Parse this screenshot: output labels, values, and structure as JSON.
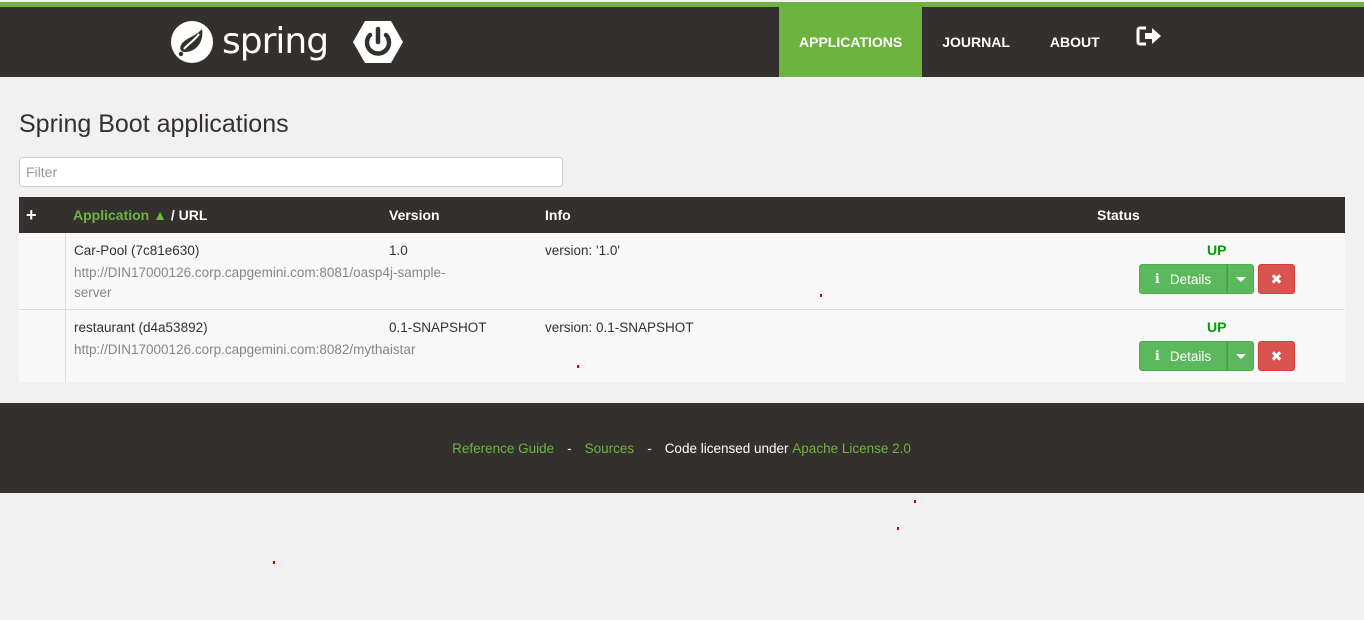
{
  "brand": {
    "name": "spring"
  },
  "nav": {
    "items": [
      {
        "label": "APPLICATIONS",
        "active": true
      },
      {
        "label": "JOURNAL",
        "active": false
      },
      {
        "label": "ABOUT",
        "active": false
      }
    ],
    "logout_icon": "sign-out-icon"
  },
  "page": {
    "title": "Spring Boot applications",
    "filter_placeholder": "Filter"
  },
  "table": {
    "headers": {
      "expand": "+",
      "application": "Application",
      "sort_indicator": "▲",
      "url": "/ URL",
      "version": "Version",
      "info": "Info",
      "status": "Status"
    },
    "rows": [
      {
        "name": "Car-Pool (7c81e630)",
        "url": "http://DIN17000126.corp.capgemini.com:8081/oasp4j-sample-server",
        "version": "1.0",
        "info": "version: '1.0'",
        "status": "UP",
        "details_label": "Details",
        "remove_label": "✖"
      },
      {
        "name": "restaurant (d4a53892)",
        "url": "http://DIN17000126.corp.capgemini.com:8082/mythaistar",
        "version": "0.1-SNAPSHOT",
        "info": "version: 0.1-SNAPSHOT",
        "status": "UP",
        "details_label": "Details",
        "remove_label": "✖"
      }
    ]
  },
  "footer": {
    "reference_guide": "Reference Guide",
    "sources": "Sources",
    "license_prefix": "Code licensed under",
    "license": "Apache License 2.0",
    "separator": "-"
  },
  "colors": {
    "brand_green": "#6db33f",
    "header_dark": "#34302d",
    "status_up": "#00a000",
    "remove_red": "#d9534f"
  }
}
